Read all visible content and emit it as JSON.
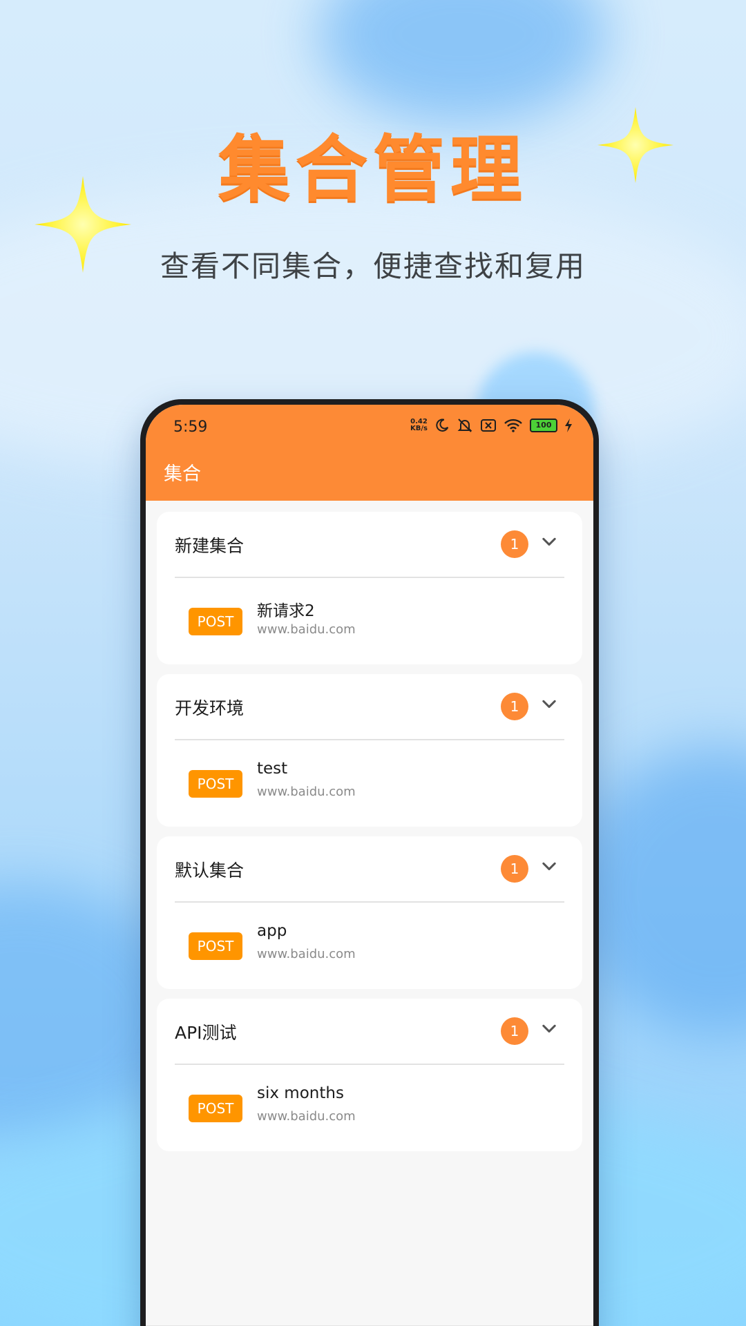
{
  "hero": {
    "title": "集合管理",
    "subtitle": "查看不同集合，便捷查找和复用"
  },
  "status_bar": {
    "time": "5:59",
    "speed_value": "0.42",
    "speed_unit": "KB/s",
    "battery": "100"
  },
  "appbar": {
    "title": "集合"
  },
  "collections": [
    {
      "name": "新建集合",
      "count": "1",
      "request": {
        "method": "POST",
        "name": "新请求2",
        "url": "www.baidu.com"
      }
    },
    {
      "name": "开发环境",
      "count": "1",
      "request": {
        "method": "POST",
        "name": "test",
        "url": "www.baidu.com"
      }
    },
    {
      "name": "默认集合",
      "count": "1",
      "request": {
        "method": "POST",
        "name": "app",
        "url": "www.baidu.com"
      }
    },
    {
      "name": "API测试",
      "count": "1",
      "request": {
        "method": "POST",
        "name": "six months",
        "url": "www.baidu.com"
      }
    }
  ],
  "colors": {
    "accent": "#fd8a36",
    "title_orange": "#ff8a2e",
    "method_tag": "#ff9500",
    "battery_green": "#4cd137"
  },
  "icons": {
    "sparkle": "sparkle-icon",
    "moon": "moon-icon",
    "mute": "bell-off-icon",
    "sim": "sim-x-icon",
    "wifi": "wifi-icon",
    "charging": "lightning-icon",
    "expand": "chevron-down-icon"
  }
}
